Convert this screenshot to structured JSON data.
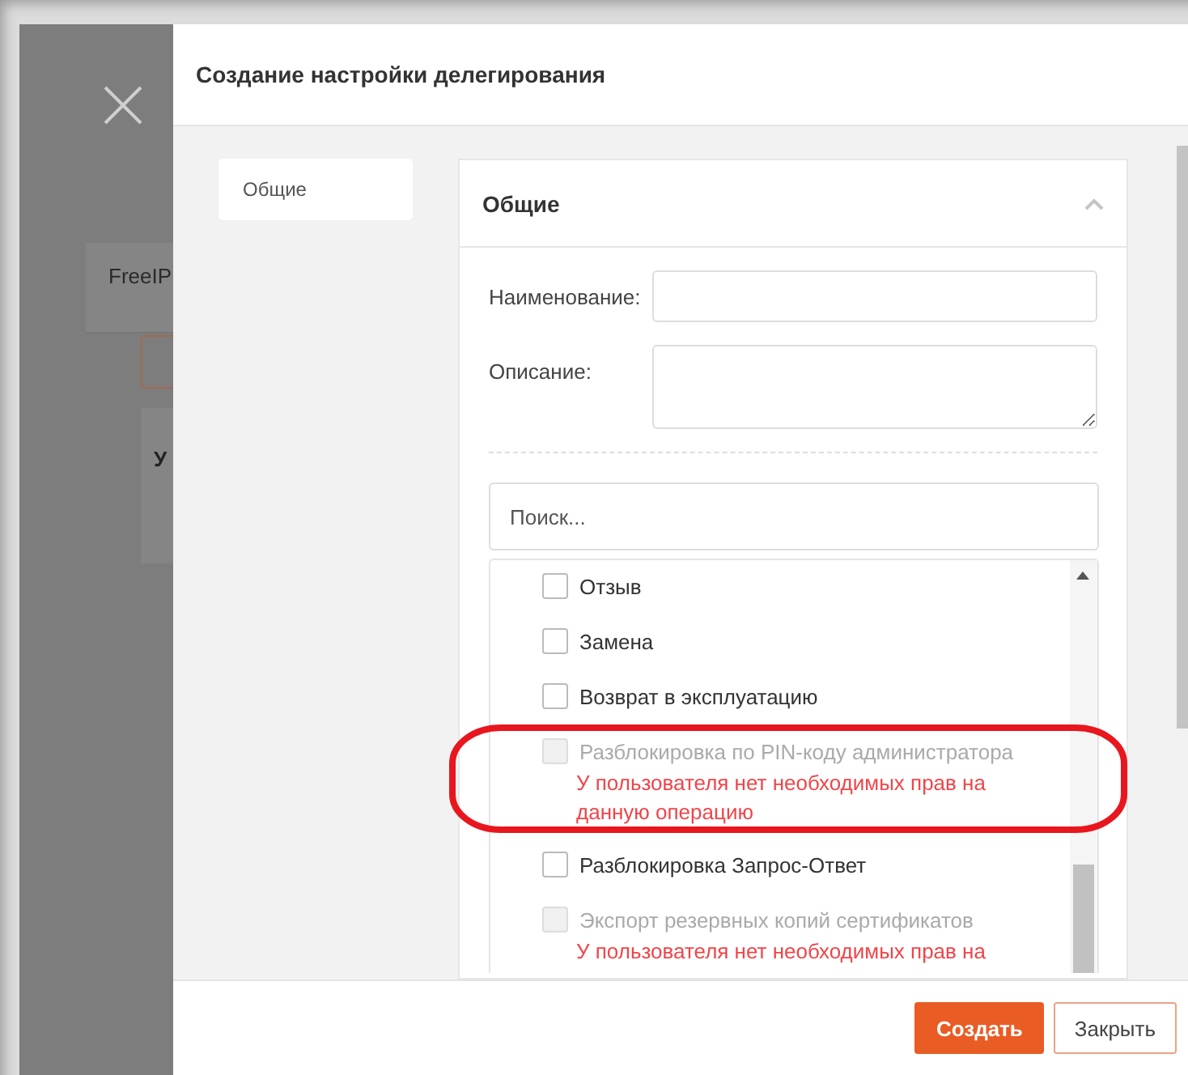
{
  "background": {
    "tab_label": "FreeIP",
    "column_header": "У"
  },
  "dialog": {
    "title": "Создание настройки делегирования",
    "nav": [
      {
        "label": "Общие",
        "selected": true
      }
    ],
    "section": {
      "title": "Общие",
      "expanded": true
    },
    "fields": [
      {
        "label": "Наименование:",
        "kind": "input"
      },
      {
        "label": "Описание:",
        "kind": "textarea"
      }
    ],
    "search": {
      "placeholder": "Поиск..."
    },
    "permissions": [
      {
        "label": "Отзыв",
        "checked": false,
        "disabled": false
      },
      {
        "label": "Замена",
        "checked": false,
        "disabled": false
      },
      {
        "label": "Возврат в эксплуатацию",
        "checked": false,
        "disabled": false
      },
      {
        "label": "Разблокировка по PIN-коду администратора",
        "checked": false,
        "disabled": true,
        "error": "У пользователя нет необходимых прав на данную операцию",
        "highlighted": true
      },
      {
        "label": "Разблокировка Запрос-Ответ",
        "checked": false,
        "disabled": false
      },
      {
        "label": "Экспорт резервных копий сертификатов",
        "checked": false,
        "disabled": true,
        "error": "У пользователя нет необходимых прав на"
      }
    ],
    "buttons": [
      {
        "label": "Создать",
        "kind": "primary"
      },
      {
        "label": "Закрыть",
        "kind": "secondary"
      }
    ]
  }
}
